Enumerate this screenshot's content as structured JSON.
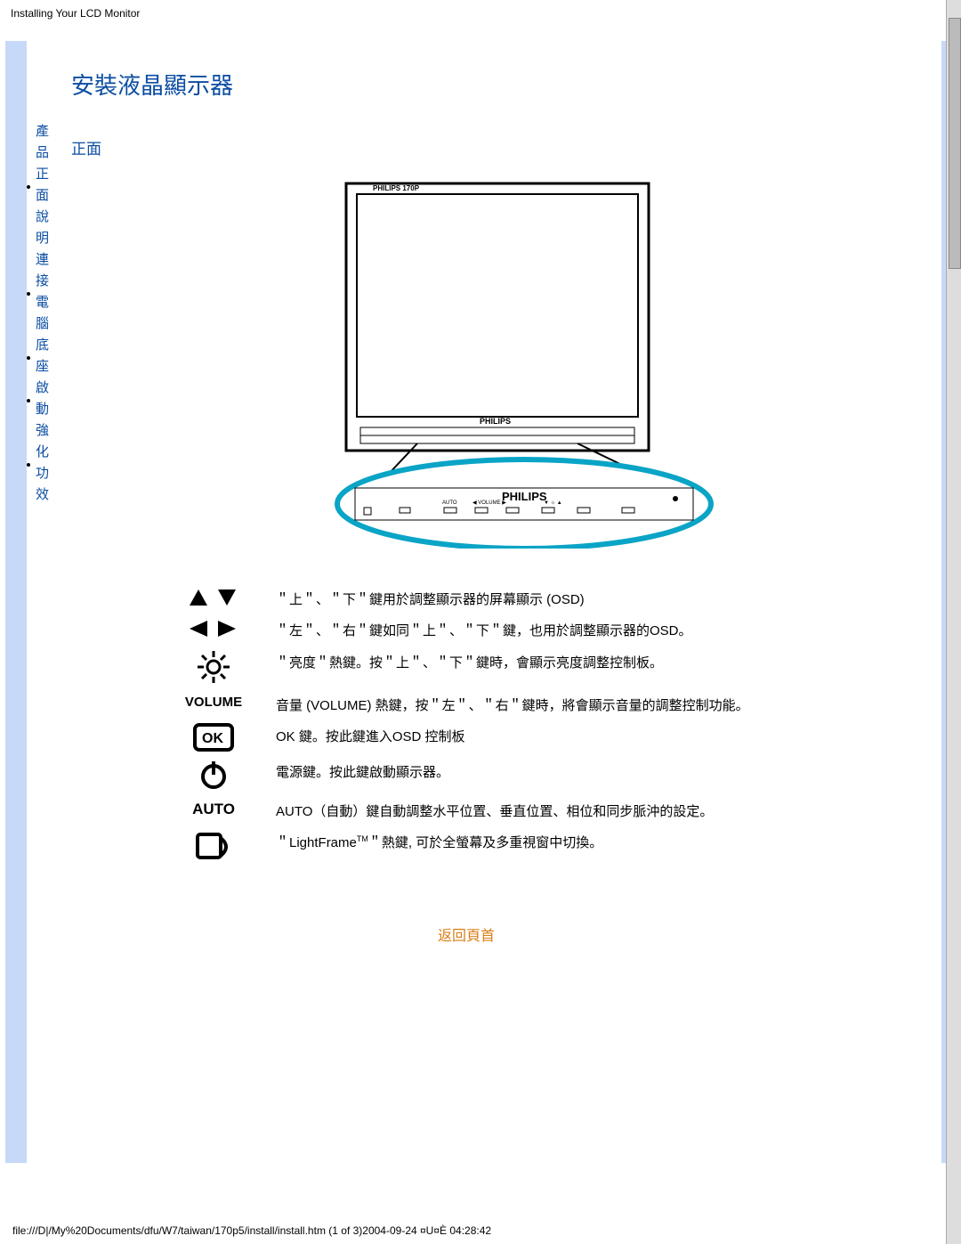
{
  "header": {
    "path": "Installing Your LCD Monitor"
  },
  "sidenav": {
    "items": [
      {
        "label": "產品正面說明"
      },
      {
        "label": "連接電腦"
      },
      {
        "label": "底座"
      },
      {
        "label": "啟動"
      },
      {
        "label": "強化功效"
      }
    ]
  },
  "title": "安裝液晶顯示器",
  "subhead": "正面",
  "brand": "PHILIPS",
  "controls": [
    {
      "icon": "up-down-icon",
      "text": "＂上＂、＂下＂鍵用於調整顯示器的屏幕顯示 (OSD)"
    },
    {
      "icon": "left-right-icon",
      "text": "＂左＂、＂右＂鍵如同＂上＂、＂下＂鍵，也用於調整顯示器的OSD。"
    },
    {
      "icon": "brightness-icon",
      "text": "＂亮度＂熱鍵。按＂上＂、＂下＂鍵時，會顯示亮度調整控制板。"
    },
    {
      "icon": "volume-label",
      "label": "VOLUME",
      "text": "音量 (VOLUME) 熱鍵，按＂左＂、＂右＂鍵時，將會顯示音量的調整控制功能。"
    },
    {
      "icon": "ok-icon",
      "text": "OK 鍵。按此鍵進入OSD 控制板"
    },
    {
      "icon": "power-icon",
      "text": "電源鍵。按此鍵啟動顯示器。"
    },
    {
      "icon": "auto-label",
      "label": "AUTO",
      "text": "AUTO（自動）鍵自動調整水平位置、垂直位置、相位和同步脈沖的設定。"
    },
    {
      "icon": "lightframe-icon",
      "html": "＂LightFrame<sup>TM</sup>＂熱鍵, 可於全螢幕及多重視窗中切換。"
    }
  ],
  "back_top": "返回頁首",
  "footer": {
    "text": "file:///D|/My%20Documents/dfu/W7/taiwan/170p5/install/install.htm (1 of 3)2004-09-24 ¤U¤È 04:28:42"
  }
}
